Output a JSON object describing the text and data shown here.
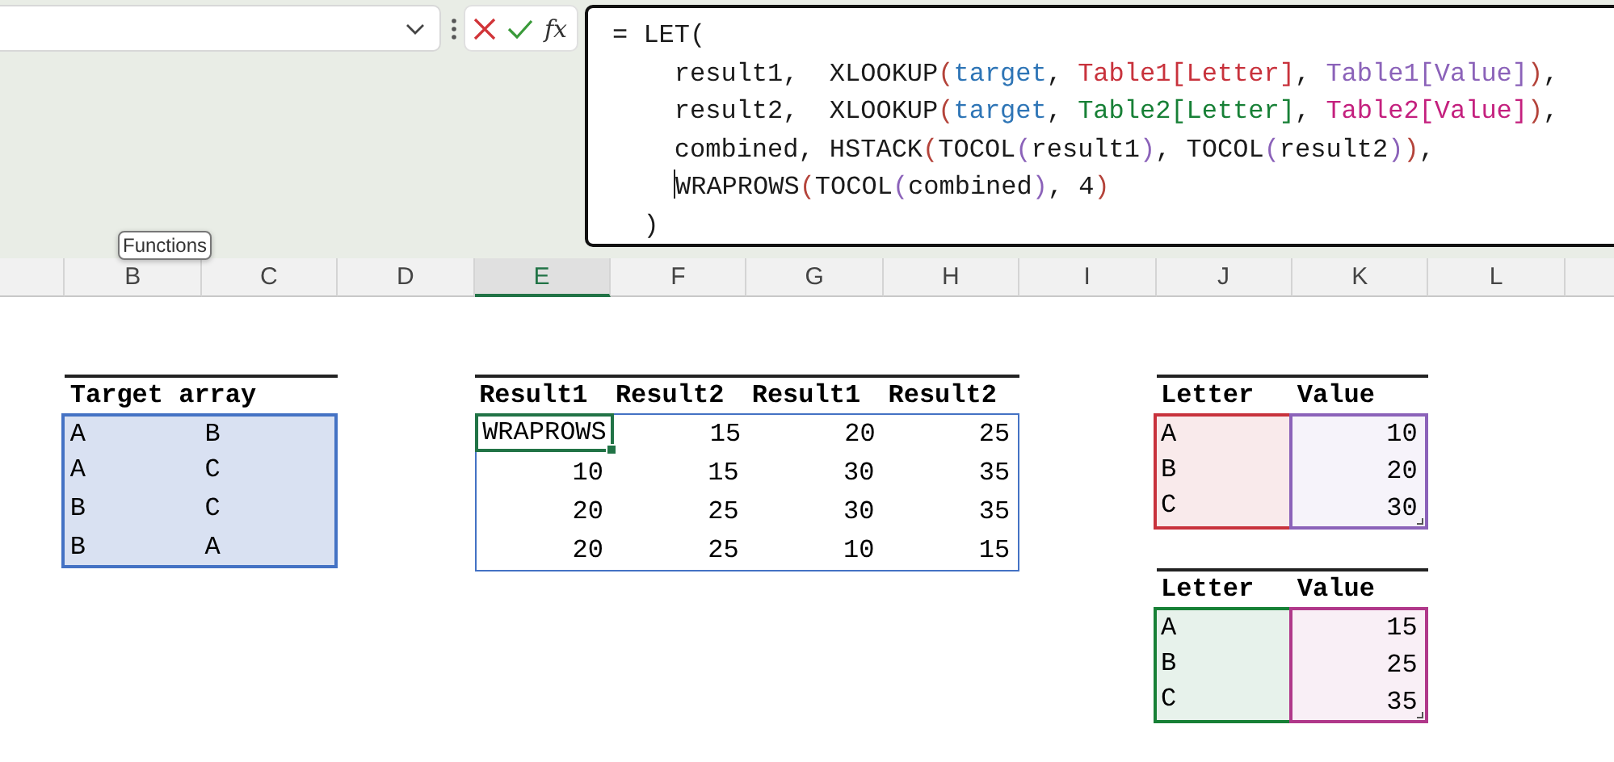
{
  "formula_bar": {
    "function_label": "fx",
    "lines": [
      {
        "caret": false,
        "segments": [
          {
            "text": "= LET(",
            "color": "#1a1a1a"
          }
        ]
      },
      {
        "caret": false,
        "segments": [
          {
            "text": "    result1,  XLOOKUP",
            "color": "#1a1a1a"
          },
          {
            "text": "(",
            "color": "#b4433a"
          },
          {
            "text": "target",
            "color": "#2e75b6"
          },
          {
            "text": ", ",
            "color": "#1a1a1a"
          },
          {
            "text": "Table1[Letter]",
            "color": "#c8323c"
          },
          {
            "text": ", ",
            "color": "#1a1a1a"
          },
          {
            "text": "Table1[Value]",
            "color": "#8b62b9"
          },
          {
            "text": ")",
            "color": "#b4433a"
          },
          {
            "text": ",",
            "color": "#1a1a1a"
          }
        ]
      },
      {
        "caret": false,
        "segments": [
          {
            "text": "    result2,  XLOOKUP",
            "color": "#1a1a1a"
          },
          {
            "text": "(",
            "color": "#b4433a"
          },
          {
            "text": "target",
            "color": "#2e75b6"
          },
          {
            "text": ", ",
            "color": "#1a1a1a"
          },
          {
            "text": "Table2[Letter]",
            "color": "#178036"
          },
          {
            "text": ", ",
            "color": "#1a1a1a"
          },
          {
            "text": "Table2[Value]",
            "color": "#c4207e"
          },
          {
            "text": ")",
            "color": "#b4433a"
          },
          {
            "text": ",",
            "color": "#1a1a1a"
          }
        ]
      },
      {
        "caret": false,
        "segments": [
          {
            "text": "    combined, HSTACK",
            "color": "#1a1a1a"
          },
          {
            "text": "(",
            "color": "#b4433a"
          },
          {
            "text": "TOCOL",
            "color": "#1a1a1a"
          },
          {
            "text": "(",
            "color": "#8b62b9"
          },
          {
            "text": "result1",
            "color": "#1a1a1a"
          },
          {
            "text": ")",
            "color": "#8b62b9"
          },
          {
            "text": ", TOCOL",
            "color": "#1a1a1a"
          },
          {
            "text": "(",
            "color": "#8b62b9"
          },
          {
            "text": "result2",
            "color": "#1a1a1a"
          },
          {
            "text": ")",
            "color": "#8b62b9"
          },
          {
            "text": ")",
            "color": "#b4433a"
          },
          {
            "text": ",",
            "color": "#1a1a1a"
          }
        ]
      },
      {
        "caret": true,
        "segments": [
          {
            "text": "WRAPROWS",
            "color": "#1a1a1a"
          },
          {
            "text": "(",
            "color": "#b4433a"
          },
          {
            "text": "TOCOL",
            "color": "#1a1a1a"
          },
          {
            "text": "(",
            "color": "#8b62b9"
          },
          {
            "text": "combined",
            "color": "#1a1a1a"
          },
          {
            "text": ")",
            "color": "#8b62b9"
          },
          {
            "text": ", 4",
            "color": "#1a1a1a"
          },
          {
            "text": ")",
            "color": "#b4433a"
          }
        ]
      },
      {
        "caret": false,
        "segments": [
          {
            "text": "  )",
            "color": "#1a1a1a"
          }
        ]
      }
    ]
  },
  "tooltip": "Functions",
  "column_headers": [
    {
      "label": "B",
      "selected": false
    },
    {
      "label": "C",
      "selected": false
    },
    {
      "label": "D",
      "selected": false
    },
    {
      "label": "E",
      "selected": true
    },
    {
      "label": "F",
      "selected": false
    },
    {
      "label": "G",
      "selected": false
    },
    {
      "label": "H",
      "selected": false
    },
    {
      "label": "I",
      "selected": false
    },
    {
      "label": "J",
      "selected": false
    },
    {
      "label": "K",
      "selected": false
    },
    {
      "label": "L",
      "selected": false
    }
  ],
  "target_table": {
    "header": "Target array",
    "rows": [
      [
        "A",
        "B"
      ],
      [
        "A",
        "C"
      ],
      [
        "B",
        "C"
      ],
      [
        "B",
        "A"
      ]
    ]
  },
  "results_table": {
    "headers": [
      "Result1",
      "Result2",
      "Result1",
      "Result2"
    ],
    "rows": [
      [
        {
          "text": "WRAPROWS",
          "kind": "text",
          "selected": true
        },
        {
          "text": "15",
          "kind": "number",
          "selected": false
        },
        {
          "text": "20",
          "kind": "number",
          "selected": false
        },
        {
          "text": "25",
          "kind": "number",
          "selected": false
        }
      ],
      [
        {
          "text": "10",
          "kind": "number",
          "selected": false
        },
        {
          "text": "15",
          "kind": "number",
          "selected": false
        },
        {
          "text": "30",
          "kind": "number",
          "selected": false
        },
        {
          "text": "35",
          "kind": "number",
          "selected": false
        }
      ],
      [
        {
          "text": "20",
          "kind": "number",
          "selected": false
        },
        {
          "text": "25",
          "kind": "number",
          "selected": false
        },
        {
          "text": "30",
          "kind": "number",
          "selected": false
        },
        {
          "text": "35",
          "kind": "number",
          "selected": false
        }
      ],
      [
        {
          "text": "20",
          "kind": "number",
          "selected": false
        },
        {
          "text": "25",
          "kind": "number",
          "selected": false
        },
        {
          "text": "10",
          "kind": "number",
          "selected": false
        },
        {
          "text": "15",
          "kind": "number",
          "selected": false
        }
      ]
    ]
  },
  "lookup_tables": [
    {
      "columns": [
        {
          "header": "Letter",
          "color": "#c8323c",
          "cells": [
            "A",
            "B",
            "C"
          ]
        },
        {
          "header": "Value",
          "color": "#8b62b9",
          "cells": [
            "10",
            "20",
            "30"
          ]
        }
      ]
    },
    {
      "columns": [
        {
          "header": "Letter",
          "color": "#178036",
          "cells": [
            "A",
            "B",
            "C"
          ]
        },
        {
          "header": "Value",
          "color": "#b0388a",
          "cells": [
            "15",
            "25",
            "35"
          ]
        }
      ]
    }
  ]
}
